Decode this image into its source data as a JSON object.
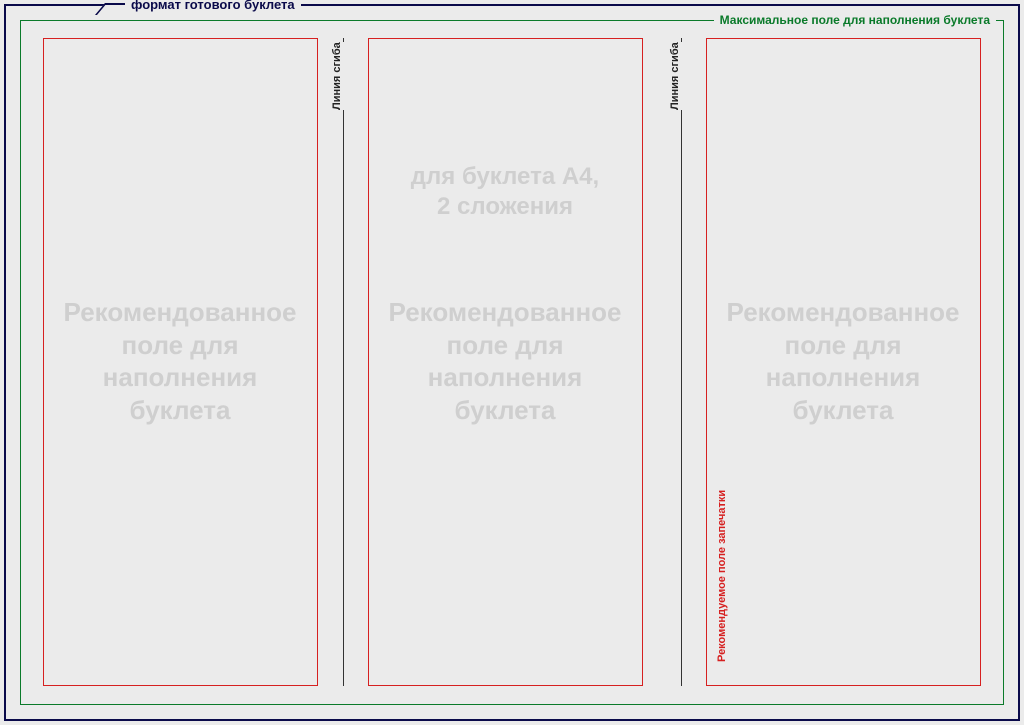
{
  "labels": {
    "format": "формат готового буклета",
    "max_field": "Максимальное поле для наполнения буклета",
    "fold_line": "Линия сгиба",
    "print_area": "Рекомендуемое поле запечатки"
  },
  "watermarks": {
    "subtitle1": "для буклета А4,",
    "subtitle2": "2 сложения",
    "line1": "Рекомендованное",
    "line2": "поле для",
    "line3": "наполнения",
    "line4": "буклета"
  }
}
